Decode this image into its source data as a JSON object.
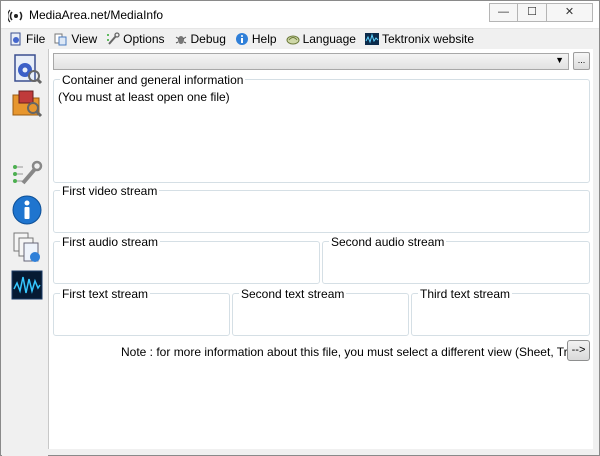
{
  "window": {
    "title": "MediaArea.net/MediaInfo",
    "controls": {
      "minimize": "—",
      "maximize": "☐",
      "close": "✕"
    }
  },
  "menu": {
    "items": [
      {
        "label": "File",
        "icon": "file-icon"
      },
      {
        "label": "View",
        "icon": "view-icon"
      },
      {
        "label": "Options",
        "icon": "options-icon"
      },
      {
        "label": "Debug",
        "icon": "debug-icon"
      },
      {
        "label": "Help",
        "icon": "help-icon"
      },
      {
        "label": "Language",
        "icon": "language-icon"
      },
      {
        "label": "Tektronix website",
        "icon": "tektronix-icon"
      }
    ]
  },
  "sidebar": {
    "buttons": [
      {
        "name": "open-file-icon"
      },
      {
        "name": "open-folder-icon"
      },
      {
        "name": "preferences-icon"
      },
      {
        "name": "about-icon"
      },
      {
        "name": "export-icon"
      },
      {
        "name": "tektronix-waveform-icon"
      }
    ]
  },
  "toolbar": {
    "file_select_value": "",
    "browse_label": "..."
  },
  "groups": {
    "general": {
      "title": "Container and general information",
      "text": "(You must at least open one file)"
    },
    "video1": {
      "title": "First video stream"
    },
    "audio1": {
      "title": "First audio stream"
    },
    "audio2": {
      "title": "Second audio stream"
    },
    "text1": {
      "title": "First text stream"
    },
    "text2": {
      "title": "Second text stream"
    },
    "text3": {
      "title": "Third text stream"
    }
  },
  "note": {
    "text": "Note : for more information about this file, you must select a different view (Sheet, Tree...",
    "button_label": "-->"
  },
  "colors": {
    "window_bg": "#f0f0f0",
    "panel_bg": "#ffffff",
    "groupbox_border": "#d5dfe5"
  }
}
